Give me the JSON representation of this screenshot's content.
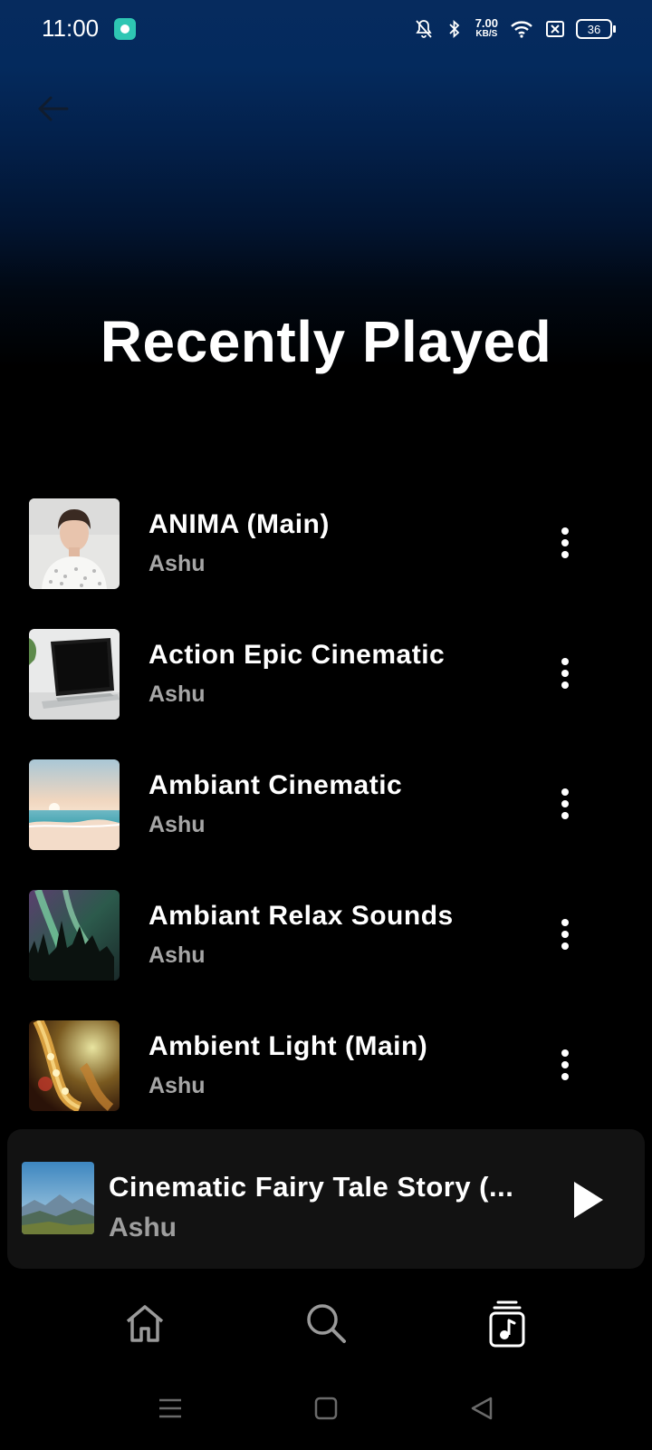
{
  "status_bar": {
    "time": "11:00",
    "net_speed_value": "7.00",
    "net_speed_unit": "KB/S",
    "battery": "36"
  },
  "header": {
    "title": "Recently Played"
  },
  "tracks": [
    {
      "title": "ANIMA (Main)",
      "artist": "Ashu",
      "thumb": "portrait"
    },
    {
      "title": "Action Epic Cinematic",
      "artist": "Ashu",
      "thumb": "laptop"
    },
    {
      "title": "Ambiant Cinematic",
      "artist": "Ashu",
      "thumb": "beach"
    },
    {
      "title": "Ambiant Relax Sounds",
      "artist": "Ashu",
      "thumb": "aurora"
    },
    {
      "title": "Ambient Light (Main)",
      "artist": "Ashu",
      "thumb": "saxophone"
    }
  ],
  "mini_player": {
    "title": "Cinematic Fairy Tale Story (...",
    "artist": "Ashu",
    "thumb": "mountains"
  },
  "bottom_nav": {
    "items": [
      "home-icon",
      "search-icon",
      "library-icon"
    ],
    "active": "library-icon"
  },
  "colors": {
    "accent_top": "#062b5e",
    "background": "#000000",
    "secondary_text": "#a6a6a6",
    "mini_player_bg": "#121212"
  }
}
